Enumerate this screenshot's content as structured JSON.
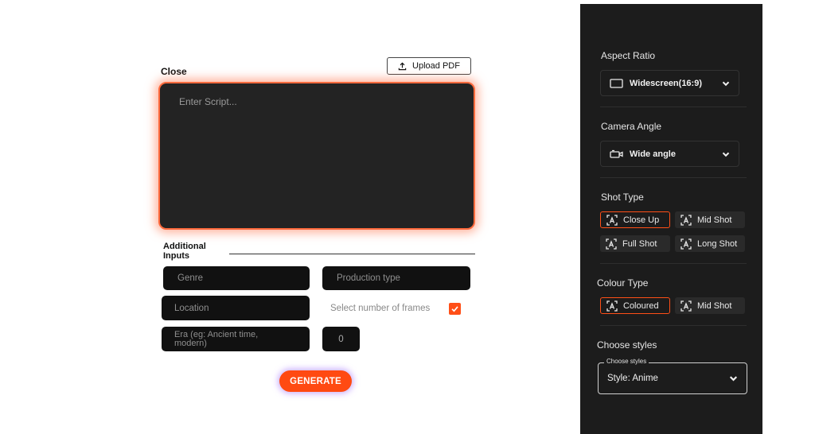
{
  "editor": {
    "close_label": "Close",
    "upload_label": "Upload PDF",
    "script_placeholder": "Enter Script...",
    "additional_inputs_label": "Additional Inputs",
    "genre_placeholder": "Genre",
    "production_type_placeholder": "Production type",
    "location_placeholder": "Location",
    "era_placeholder": "Era (eg: Ancient time, modern)",
    "frames_label": "Select number of frames",
    "frames_checked": true,
    "frames_value": "0",
    "generate_label": "GENERATE"
  },
  "panel": {
    "aspect_ratio": {
      "label": "Aspect Ratio",
      "value": "Widescreen(16:9)",
      "icon": "rectangle-icon"
    },
    "camera_angle": {
      "label": "Camera Angle",
      "value": "Wide angle",
      "icon": "camera-icon"
    },
    "shot_type": {
      "label": "Shot Type",
      "options": [
        {
          "label": "Close Up",
          "active": true
        },
        {
          "label": "Mid Shot",
          "active": false
        },
        {
          "label": "Full Shot",
          "active": false
        },
        {
          "label": "Long Shot",
          "active": false
        }
      ]
    },
    "colour_type": {
      "label": "Colour Type",
      "options": [
        {
          "label": "Coloured",
          "active": true
        },
        {
          "label": "Mid Shot",
          "active": false
        }
      ]
    },
    "choose_styles": {
      "label": "Choose styles",
      "legend": "Choose styles",
      "value": "Style: Anime"
    }
  },
  "colors": {
    "accent": "#ff4f17",
    "panel_bg": "#1c1c1c",
    "field_bg": "#111111"
  }
}
